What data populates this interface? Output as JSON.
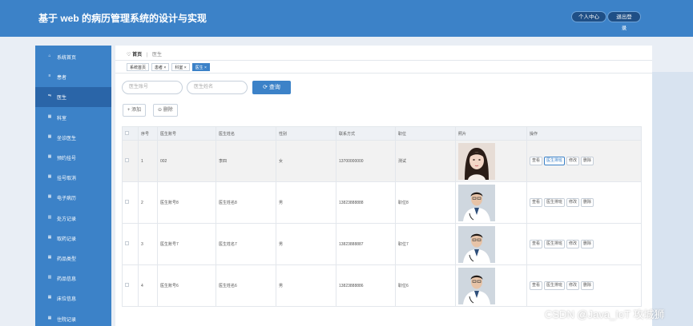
{
  "app": {
    "title": "基于 web 的病历管理系统的设计与实现",
    "profile_label": "个人中心",
    "logout_label": "退出登录"
  },
  "sidebar": {
    "items": [
      {
        "label": "系统首页",
        "icon": "home-icon"
      },
      {
        "label": "患者",
        "icon": "list-icon"
      },
      {
        "label": "医生",
        "icon": "sliders-icon",
        "active": true
      },
      {
        "label": "科室",
        "icon": "grid-icon"
      },
      {
        "label": "坐诊医生",
        "icon": "grid-icon"
      },
      {
        "label": "预约挂号",
        "icon": "grid-icon"
      },
      {
        "label": "挂号取消",
        "icon": "grid-icon"
      },
      {
        "label": "电子病历",
        "icon": "grid-icon"
      },
      {
        "label": "处方记录",
        "icon": "chart-icon"
      },
      {
        "label": "取药记录",
        "icon": "grid-icon"
      },
      {
        "label": "药品类型",
        "icon": "grid-icon"
      },
      {
        "label": "药品信息",
        "icon": "chart-icon"
      },
      {
        "label": "床位信息",
        "icon": "grid-icon"
      },
      {
        "label": "住院记录",
        "icon": "grid-icon"
      }
    ]
  },
  "breadcrumb": {
    "home": "首页",
    "current": "医生"
  },
  "tabs": [
    {
      "label": "系统首页"
    },
    {
      "label": "患者 ×"
    },
    {
      "label": "科室 ×"
    },
    {
      "label": "医生 ×",
      "active": true
    }
  ],
  "search": {
    "account_placeholder": "医生账号",
    "name_placeholder": "医生姓名",
    "button_label": "查询"
  },
  "actions": {
    "add_label": "+ 添加",
    "delete_label": "⊝ 删除"
  },
  "table": {
    "headers": [
      "",
      "序号",
      "医生账号",
      "医生姓名",
      "性别",
      "联系方式",
      "职位",
      "照片",
      "操作"
    ],
    "rows": [
      {
        "index": "1",
        "account": "002",
        "name": "李四",
        "gender": "女",
        "phone": "13700000000",
        "position": "测试",
        "photo": "female-doctor",
        "highlight": true
      },
      {
        "index": "2",
        "account": "医生账号8",
        "name": "医生姓名8",
        "gender": "男",
        "phone": "13823888888",
        "position": "职位8",
        "photo": "male-doctor"
      },
      {
        "index": "3",
        "account": "医生账号7",
        "name": "医生姓名7",
        "gender": "男",
        "phone": "13823888887",
        "position": "职位7",
        "photo": "male-doctor"
      },
      {
        "index": "4",
        "account": "医生账号6",
        "name": "医生姓名6",
        "gender": "男",
        "phone": "13823888886",
        "position": "职位6",
        "photo": "male-doctor"
      }
    ],
    "ops": [
      "查看",
      "医生排班",
      "修改",
      "删除"
    ]
  },
  "watermark": "CSDN @Java_IoT 攻城狮",
  "colors": {
    "primary": "#3c82c8",
    "active_sidebar": "#2a65a8",
    "header_row": "#eef1f5"
  }
}
